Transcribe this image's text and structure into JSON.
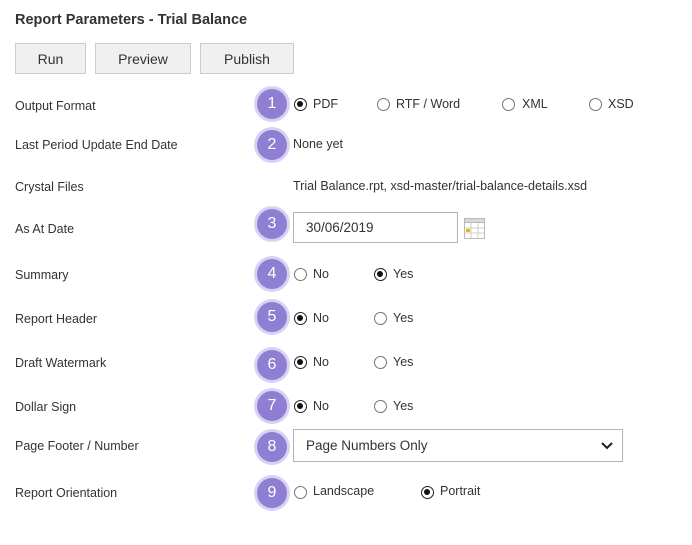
{
  "header": {
    "title": "Report Parameters - Trial Balance"
  },
  "toolbar": {
    "run_label": "Run",
    "preview_label": "Preview",
    "publish_label": "Publish"
  },
  "rows": {
    "output_format": {
      "label": "Output Format",
      "step": "1",
      "options": [
        "PDF",
        "RTF / Word",
        "XML",
        "XSD"
      ],
      "selected": "PDF"
    },
    "last_period": {
      "label": "Last Period Update End Date",
      "step": "2",
      "value": "None yet"
    },
    "crystal_files": {
      "label": "Crystal Files",
      "value": "Trial Balance.rpt, xsd-master/trial-balance-details.xsd"
    },
    "as_at_date": {
      "label": "As At Date",
      "step": "3",
      "value": "30/06/2019",
      "icon": "calendar-icon"
    },
    "summary": {
      "label": "Summary",
      "step": "4",
      "options": [
        "No",
        "Yes"
      ],
      "selected": "Yes"
    },
    "report_header": {
      "label": "Report Header",
      "step": "5",
      "options": [
        "No",
        "Yes"
      ],
      "selected": "No"
    },
    "draft_watermark": {
      "label": "Draft Watermark",
      "step": "6",
      "options": [
        "No",
        "Yes"
      ],
      "selected": "No"
    },
    "dollar_sign": {
      "label": "Dollar Sign",
      "step": "7",
      "options": [
        "No",
        "Yes"
      ],
      "selected": "No"
    },
    "page_footer": {
      "label": "Page Footer / Number",
      "step": "8",
      "value": "Page Numbers Only",
      "icon": "chevron-down-icon"
    },
    "report_orientation": {
      "label": "Report Orientation",
      "step": "9",
      "options": [
        "Landscape",
        "Portrait"
      ],
      "selected": "Portrait"
    }
  },
  "colors": {
    "badge": "#8f7fd3",
    "badge_ring": "#d9d1f3",
    "button_bg": "#f0f0f0"
  }
}
